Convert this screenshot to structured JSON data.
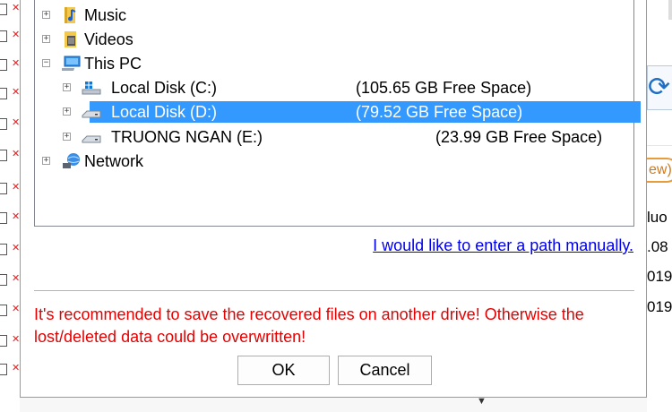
{
  "tree": {
    "items": [
      {
        "label": "Music",
        "icon": "music-folder-icon"
      },
      {
        "label": "Videos",
        "icon": "videos-folder-icon"
      },
      {
        "label": "This PC",
        "icon": "computer-icon"
      },
      {
        "label": "Local Disk (C:)",
        "free": "(105.65 GB Free Space)",
        "icon": "windows-drive-icon"
      },
      {
        "label": "Local Disk (D:)",
        "free": "(79.52 GB Free Space)",
        "icon": "drive-icon",
        "selected": true
      },
      {
        "label": "TRUONG NGAN (E:)",
        "free": "(23.99 GB Free Space)",
        "icon": "drive-icon"
      },
      {
        "label": "Network",
        "icon": "network-icon"
      }
    ]
  },
  "dialog": {
    "manual_path_link": "I would like to enter a path manually.",
    "warning": "It's recommended to save the recovered files on another drive! Otherwise the lost/deleted data could be overwritten!",
    "ok_label": "OK",
    "cancel_label": "Cancel"
  },
  "background_right": {
    "pill_text": "ew)",
    "rows": [
      "luo",
      ".08",
      "019",
      "019"
    ]
  },
  "colors": {
    "selection": "#3399ff",
    "warning": "#e60000",
    "link": "#0000ee"
  }
}
